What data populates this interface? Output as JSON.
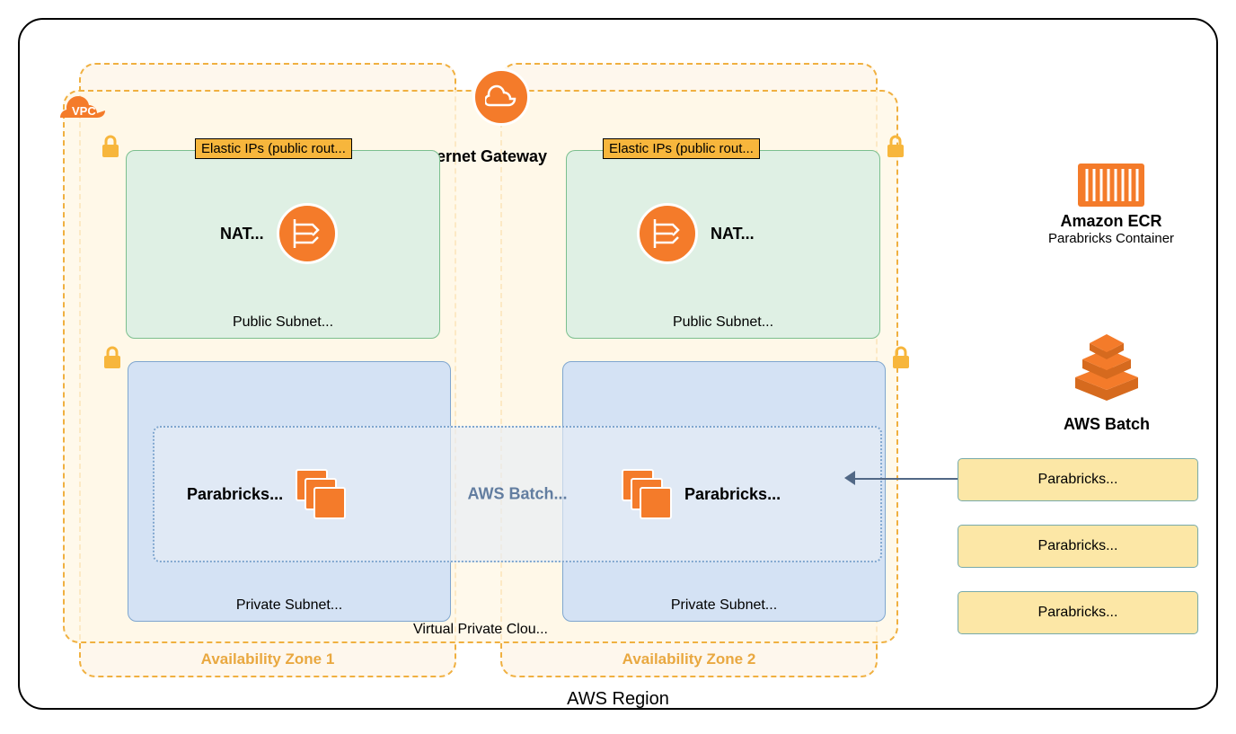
{
  "region": {
    "label": "AWS Region"
  },
  "az": {
    "az1_label": "Availability Zone 1",
    "az2_label": "Availability Zone 2"
  },
  "vpc": {
    "label": "Virtual Private Clou...",
    "badge": "VPC"
  },
  "igw": {
    "label": "Internet Gateway"
  },
  "public_subnet": {
    "eip_label": "Elastic IPs (public rout...",
    "nat_label": "NAT...",
    "subnet_label": "Public Subnet..."
  },
  "private_subnet": {
    "parabricks_label": "Parabricks...",
    "subnet_label": "Private Subnet..."
  },
  "batch_inline": {
    "label": "AWS Batch..."
  },
  "ecr": {
    "title": "Amazon ECR",
    "subtitle": "Parabricks Container"
  },
  "aws_batch": {
    "title": "AWS Batch",
    "queues": [
      "Parabricks...",
      "Parabricks...",
      "Parabricks..."
    ]
  }
}
